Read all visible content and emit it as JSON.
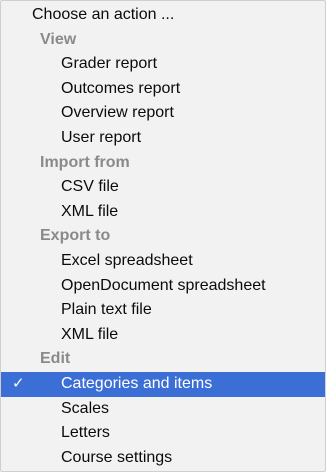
{
  "menu": {
    "header": "Choose an action ...",
    "groups": [
      {
        "label": "View",
        "items": [
          "Grader report",
          "Outcomes report",
          "Overview report",
          "User report"
        ]
      },
      {
        "label": "Import from",
        "items": [
          "CSV file",
          "XML file"
        ]
      },
      {
        "label": "Export to",
        "items": [
          "Excel spreadsheet",
          "OpenDocument spreadsheet",
          "Plain text file",
          "XML file"
        ]
      },
      {
        "label": "Edit",
        "items": [
          "Categories and items",
          "Scales",
          "Letters",
          "Course settings"
        ]
      }
    ],
    "selected": {
      "label": "Categories and items",
      "check_glyph": "✓",
      "check_icon": "checkmark-icon"
    },
    "colors": {
      "background": "#f2f2f2",
      "group_label": "#8a8a8a",
      "selection": "#3b6fd6",
      "selected_text": "#ffffff"
    }
  }
}
